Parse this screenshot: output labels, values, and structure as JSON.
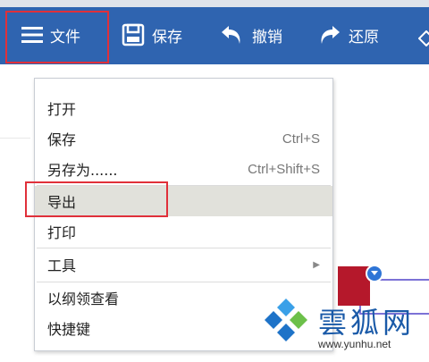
{
  "toolbar": {
    "file_label": "文件",
    "save_label": "保存",
    "undo_label": "撤销",
    "redo_label": "还原",
    "accent": "#2f64b0"
  },
  "menu": {
    "items": [
      {
        "label": "打开",
        "shortcut": ""
      },
      {
        "label": "保存",
        "shortcut": "Ctrl+S"
      },
      {
        "label": "另存为......",
        "shortcut": "Ctrl+Shift+S"
      },
      {
        "label": "导出",
        "shortcut": "",
        "selected": true
      },
      {
        "label": "打印",
        "shortcut": ""
      },
      {
        "label": "工具",
        "shortcut": "",
        "submenu": true
      },
      {
        "label": "以纲领查看",
        "shortcut": ""
      },
      {
        "label": "快捷键",
        "shortcut": ""
      }
    ],
    "highlight_color": "#e0303a"
  },
  "icons": {
    "menu": "hamburger-icon",
    "save": "floppy-disk-icon",
    "undo": "undo-arrow-icon",
    "redo": "redo-arrow-icon",
    "submenu": "chevron-right-icon",
    "node_toggle": "chevron-down-icon"
  },
  "watermark": {
    "text": "雲狐网",
    "url": "www.yunhu.net"
  }
}
